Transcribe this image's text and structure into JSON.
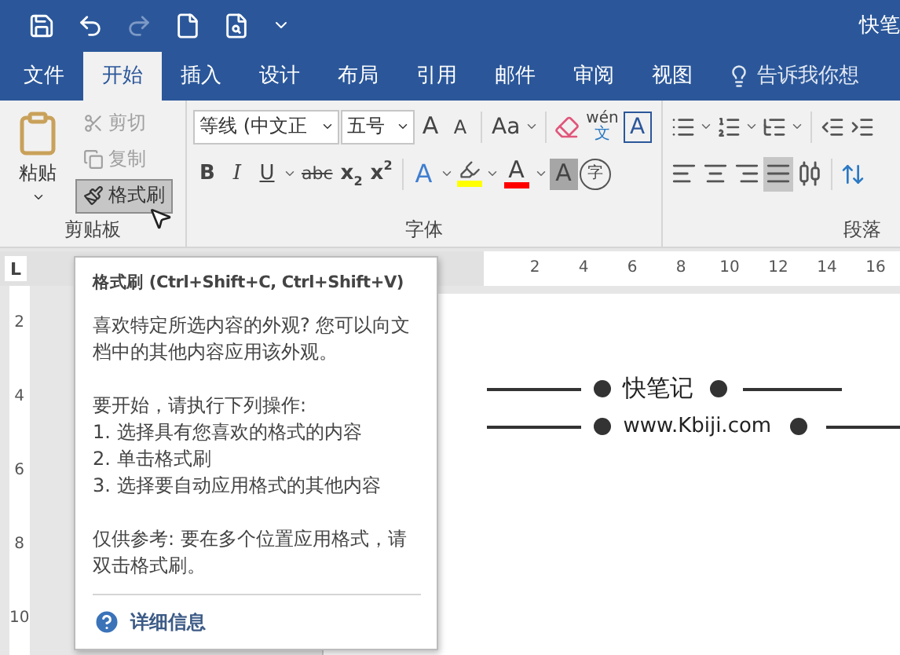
{
  "quick_access": [
    {
      "kind": "save",
      "disabled": false
    },
    {
      "kind": "undo",
      "disabled": false
    },
    {
      "kind": "redo",
      "disabled": true
    },
    {
      "kind": "new",
      "disabled": false
    },
    {
      "kind": "preview",
      "disabled": false
    },
    {
      "kind": "customize",
      "disabled": false
    }
  ],
  "window": {
    "title": "快笔"
  },
  "tabs": [
    {
      "label": "文件",
      "selected": false
    },
    {
      "label": "开始",
      "selected": true
    },
    {
      "label": "插入",
      "selected": false
    },
    {
      "label": "设计",
      "selected": false
    },
    {
      "label": "布局",
      "selected": false
    },
    {
      "label": "引用",
      "selected": false
    },
    {
      "label": "邮件",
      "selected": false
    },
    {
      "label": "审阅",
      "selected": false
    },
    {
      "label": "视图",
      "selected": false
    }
  ],
  "tell_me": {
    "placeholder": "告诉我你想"
  },
  "clipboard": {
    "label": "剪贴板",
    "paste": "粘贴",
    "items": [
      {
        "kind": "cut",
        "label": "剪切",
        "disabled": true,
        "selected": false
      },
      {
        "kind": "copy",
        "label": "复制",
        "disabled": true,
        "selected": false
      },
      {
        "kind": "painter",
        "label": "格式刷",
        "disabled": false,
        "selected": true
      }
    ]
  },
  "font": {
    "label": "字体",
    "font_name": "等线 (中文正",
    "font_size": "五号",
    "row1": [
      {
        "kind": "grow",
        "glyph": "A"
      },
      {
        "kind": "shrink",
        "glyph": "A"
      },
      {
        "kind": "case",
        "glyph": "Aa"
      },
      {
        "kind": "clear"
      },
      {
        "kind": "phonetic",
        "glyph": "wén",
        "sub": "文"
      },
      {
        "kind": "border",
        "glyph": "A"
      }
    ],
    "row2": [
      {
        "kind": "bold",
        "glyph": "B"
      },
      {
        "kind": "italic",
        "glyph": "I"
      },
      {
        "kind": "underline",
        "glyph": "U"
      },
      {
        "kind": "strike",
        "glyph": "abc"
      },
      {
        "kind": "subscript",
        "glyph": "x$_{2}$"
      },
      {
        "kind": "superscript",
        "glyph": "x$^{2}$"
      },
      {
        "kind": "effects",
        "glyph": "A"
      },
      {
        "kind": "highlight",
        "color": "#ffff00"
      },
      {
        "kind": "color",
        "glyph": "A",
        "color": "#ff0000"
      },
      {
        "kind": "shading",
        "glyph": "A"
      },
      {
        "kind": "enclose",
        "glyph": "字"
      }
    ]
  },
  "paragraph": {
    "label": "段落",
    "alignment": [
      {
        "kind": "left",
        "selected": false
      },
      {
        "kind": "center",
        "selected": false
      },
      {
        "kind": "right",
        "selected": false
      },
      {
        "kind": "justify",
        "selected": true
      },
      {
        "kind": "distributed",
        "selected": false
      }
    ]
  },
  "ruler": {
    "tab_stop": "L",
    "numbers": [
      "2",
      "4",
      "6",
      "8",
      "10",
      "12",
      "14",
      "16"
    ],
    "vertical_numbers": [
      "2",
      "4",
      "6",
      "8",
      "10"
    ]
  },
  "document": {
    "lines": [
      "快笔记",
      "www.Kbiji.com"
    ]
  },
  "tooltip": {
    "title": "格式刷 (Ctrl+Shift+C, Ctrl+Shift+V)",
    "paragraphs": [
      "喜欢特定所选内容的外观? 您可以向文档中的其他内容应用该外观。"
    ],
    "intro": "要开始，请执行下列操作:",
    "steps": [
      "1. 选择具有您喜欢的格式的内容",
      "2. 单击格式刷",
      "3. 选择要自动应用格式的其他内容"
    ],
    "note": "仅供参考: 要在多个位置应用格式，请双击格式刷。",
    "link": "详细信息"
  }
}
